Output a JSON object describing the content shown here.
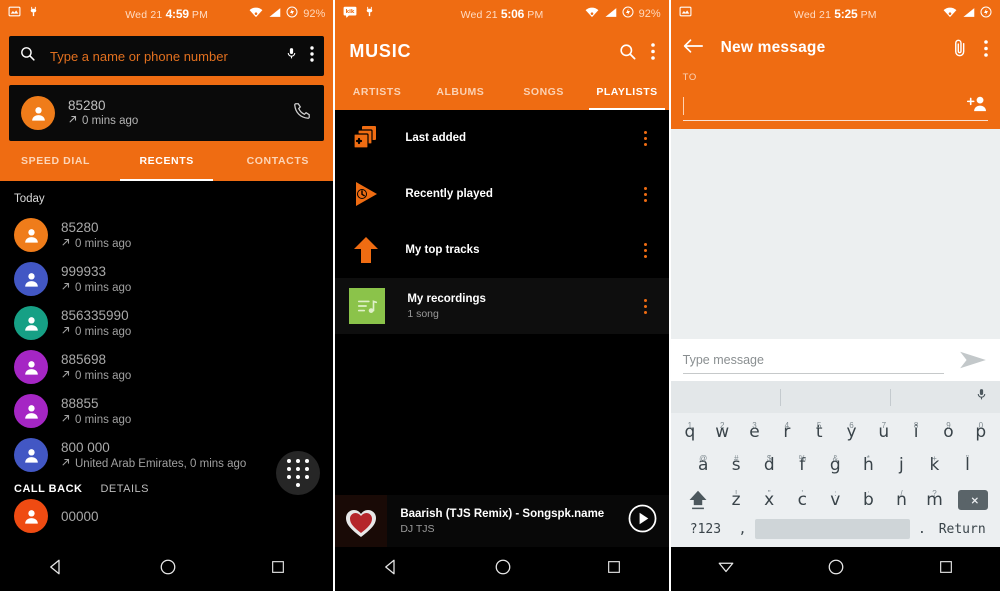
{
  "panels": {
    "dialer": {
      "status": {
        "time": "4:59",
        "date": "Wed 21",
        "ampm": "PM",
        "battery": "92%",
        "icons_left": [
          "screenshot-icon",
          "android-debug-icon"
        ],
        "icons_right": [
          "wifi-icon",
          "signal-icon",
          "battery-saver-icon"
        ]
      },
      "search": {
        "placeholder": "Type a name or phone number",
        "value": "",
        "search_icon": "search-icon",
        "mic_icon": "microphone-icon",
        "overflow_icon": "overflow-menu-icon"
      },
      "call_card": {
        "number": "85280",
        "detail": "0 mins ago",
        "direction_icon": "outgoing-call-icon",
        "call_icon": "phone-handset-icon",
        "avatar_color": "#ef7c1a"
      },
      "tabs": [
        {
          "label": "SPEED DIAL",
          "active": false
        },
        {
          "label": "RECENTS",
          "active": true
        },
        {
          "label": "CONTACTS",
          "active": false
        }
      ],
      "day_label": "Today",
      "recents": [
        {
          "number": "85280",
          "detail": "0 mins ago",
          "color": "#ef7c1a"
        },
        {
          "number": "999933",
          "detail": "0 mins ago",
          "color": "#4257c4"
        },
        {
          "number": "856335990",
          "detail": "0 mins ago",
          "color": "#16a085"
        },
        {
          "number": "885698",
          "detail": "0 mins ago",
          "color": "#a526c4"
        },
        {
          "number": "88855",
          "detail": "0 mins ago",
          "color": "#a526c4"
        },
        {
          "number": "800 000",
          "detail": "United Arab Emirates, 0 mins ago",
          "color": "#4257c4"
        }
      ],
      "expanded_actions": {
        "call_back": "CALL BACK",
        "details": "DETAILS"
      },
      "partial_row": {
        "number": "00000",
        "color": "#ef4b12"
      },
      "fab": {
        "icon": "dialpad-icon"
      },
      "nav": {
        "back": "back-icon",
        "home": "home-icon",
        "recents": "recent-apps-icon"
      }
    },
    "music": {
      "status": {
        "time": "5:06",
        "date": "Wed 21",
        "ampm": "PM",
        "battery": "92%",
        "icons_left": [
          "kik-messenger-icon",
          "android-debug-icon"
        ],
        "icons_right": [
          "wifi-icon",
          "signal-icon",
          "battery-saver-icon"
        ]
      },
      "title": "MUSIC",
      "header_icons": {
        "search": "search-icon",
        "overflow": "overflow-menu-icon"
      },
      "tabs": [
        {
          "label": "ARTISTS",
          "active": false
        },
        {
          "label": "ALBUMS",
          "active": false
        },
        {
          "label": "SONGS",
          "active": false
        },
        {
          "label": "PLAYLISTS",
          "active": true
        }
      ],
      "playlists": [
        {
          "title": "Last added",
          "subtitle": "",
          "icon": "add-to-playlist-icon",
          "icon_color": "#ef6c12",
          "selected": false
        },
        {
          "title": "Recently played",
          "subtitle": "",
          "icon": "recently-played-icon",
          "icon_color": "#ef6c12",
          "selected": false
        },
        {
          "title": "My top tracks",
          "subtitle": "",
          "icon": "top-tracks-arrow-icon",
          "icon_color": "#ef6c12",
          "selected": false
        },
        {
          "title": "My recordings",
          "subtitle": "1 song",
          "icon": "playlist-note-icon",
          "icon_color": "#8bc34a",
          "selected": true
        }
      ],
      "now_playing": {
        "title": "Baarish (TJS Remix) - Songspk.name",
        "artist": "DJ TJS",
        "play_icon": "play-circle-icon",
        "album_art": "heart-album-art"
      },
      "nav": {
        "back": "back-icon",
        "home": "home-icon",
        "recents": "recent-apps-icon"
      }
    },
    "messaging": {
      "status": {
        "time": "5:25",
        "date": "Wed 21",
        "ampm": "PM",
        "battery": "",
        "icons_left": [
          "screenshot-icon"
        ],
        "icons_right": [
          "wifi-icon",
          "signal-icon",
          "battery-saver-icon"
        ]
      },
      "title": "New message",
      "back_icon": "back-arrow-icon",
      "header_icons": {
        "attach": "paperclip-icon",
        "overflow": "overflow-menu-icon"
      },
      "to_field": {
        "label": "TO",
        "value": "",
        "add_contact_icon": "add-contact-icon"
      },
      "composer": {
        "placeholder": "Type message",
        "value": "",
        "send_icon": "send-icon"
      },
      "keyboard": {
        "mic_icon": "microphone-icon",
        "row1": [
          {
            "key": "q",
            "alt": "1"
          },
          {
            "key": "w",
            "alt": "2"
          },
          {
            "key": "e",
            "alt": "3"
          },
          {
            "key": "r",
            "alt": "4"
          },
          {
            "key": "t",
            "alt": "5"
          },
          {
            "key": "y",
            "alt": "6"
          },
          {
            "key": "u",
            "alt": "7"
          },
          {
            "key": "i",
            "alt": "8"
          },
          {
            "key": "o",
            "alt": "9"
          },
          {
            "key": "p",
            "alt": "0"
          }
        ],
        "row2": [
          {
            "key": "a",
            "alt": "@"
          },
          {
            "key": "s",
            "alt": "#"
          },
          {
            "key": "d",
            "alt": "$"
          },
          {
            "key": "f",
            "alt": "%"
          },
          {
            "key": "g",
            "alt": "&"
          },
          {
            "key": "h",
            "alt": "*"
          },
          {
            "key": "j",
            "alt": "-"
          },
          {
            "key": "k",
            "alt": "+"
          },
          {
            "key": "l",
            "alt": "\""
          }
        ],
        "row3": [
          {
            "key": "z",
            "alt": "!"
          },
          {
            "key": "x",
            "alt": "\""
          },
          {
            "key": "c",
            "alt": "'"
          },
          {
            "key": "v",
            "alt": ":"
          },
          {
            "key": "b",
            "alt": ";"
          },
          {
            "key": "n",
            "alt": "/"
          },
          {
            "key": "m",
            "alt": "?"
          }
        ],
        "shift_icon": "shift-key-icon",
        "backspace_icon": "backspace-key-icon",
        "symbols_key": "?123",
        "comma_key": ",",
        "period_key": ".",
        "return_key": "Return",
        "space_key": ""
      },
      "nav": {
        "back": "keyboard-down-icon",
        "home": "home-icon",
        "recents": "recent-apps-icon"
      }
    }
  },
  "colors": {
    "orange": "#ef6c12",
    "dark": "#000000",
    "card": "#0a0a0a",
    "keyboard_bg": "#eceff1",
    "green": "#8bc34a"
  }
}
